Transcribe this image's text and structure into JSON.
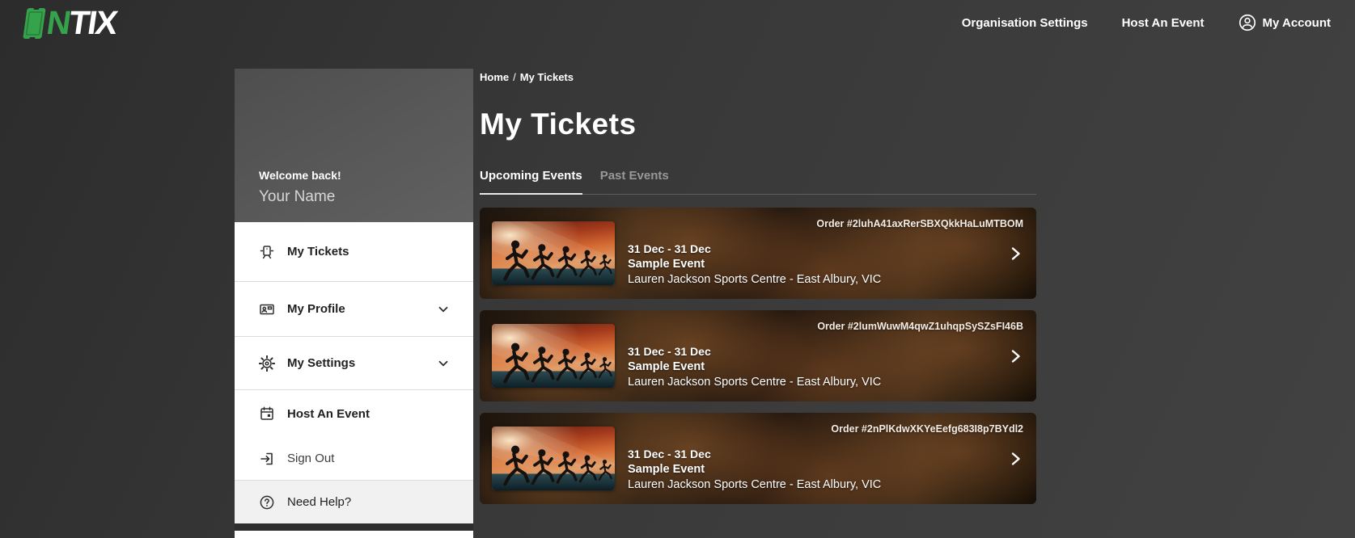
{
  "header": {
    "logo": {
      "green_letter": "N",
      "white_letters": "TIX"
    },
    "nav": {
      "organisation_settings": "Organisation Settings",
      "host_an_event": "Host An Event",
      "my_account": "My Account"
    }
  },
  "sidebar": {
    "greeting": "Welcome back!",
    "username": "Your Name",
    "menu": {
      "my_tickets": "My Tickets",
      "my_profile": "My Profile",
      "my_settings": "My Settings",
      "host_an_event": "Host An Event",
      "sign_out": "Sign Out",
      "need_help": "Need Help?"
    }
  },
  "main": {
    "breadcrumb": {
      "home": "Home",
      "separator": "/",
      "current": "My Tickets"
    },
    "title": "My Tickets",
    "tabs": {
      "upcoming": "Upcoming Events",
      "past": "Past Events"
    },
    "tickets": [
      {
        "order": "Order #2luhA41axRerSBXQkkHaLuMTBOM",
        "dates": "31 Dec - 31 Dec",
        "event": "Sample Event",
        "venue": "Lauren Jackson Sports Centre - East Albury, VIC"
      },
      {
        "order": "Order #2lumWuwM4qwZ1uhqpSySZsFI46B",
        "dates": "31 Dec - 31 Dec",
        "event": "Sample Event",
        "venue": "Lauren Jackson Sports Centre - East Albury, VIC"
      },
      {
        "order": "Order #2nPlKdwXKYeEefg683I8p7BYdl2",
        "dates": "31 Dec - 31 Dec",
        "event": "Sample Event",
        "venue": "Lauren Jackson Sports Centre - East Albury, VIC"
      }
    ]
  },
  "colors": {
    "brand_green": "#35a24c",
    "page_background": "#3a3a3a",
    "active_tab_underline": "#e9e9e9",
    "card_text": "#ffffff"
  }
}
